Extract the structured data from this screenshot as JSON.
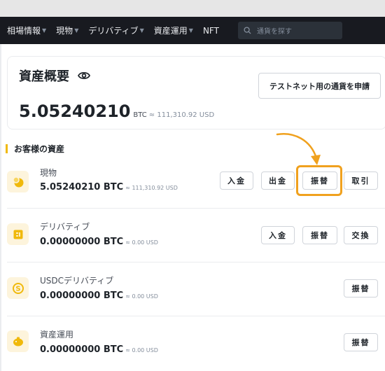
{
  "nav": {
    "items": [
      {
        "label": "相場情報",
        "caret": true
      },
      {
        "label": "現物",
        "caret": true
      },
      {
        "label": "デリバティブ",
        "caret": true
      },
      {
        "label": "資産運用",
        "caret": true
      },
      {
        "label": "NFT",
        "caret": false
      }
    ],
    "search_placeholder": "通貨を探す"
  },
  "summary": {
    "title": "資産概要",
    "balance": "5.05240210",
    "unit": "BTC",
    "fiat": "≈ 111,310.92 USD",
    "testnet_button": "テストネット用の通貨を申請"
  },
  "section": {
    "title": "お客様の資産"
  },
  "assets": [
    {
      "name": "現物",
      "balance": "5.05240210 BTC",
      "fiat": "≈ 111,310.92 USD",
      "icon": "spot-icon",
      "actions": [
        "入金",
        "出金",
        "振替",
        "取引"
      ]
    },
    {
      "name": "デリバティブ",
      "balance": "0.00000000 BTC",
      "fiat": "≈ 0.00 USD",
      "icon": "derivatives-icon",
      "actions": [
        "入金",
        "振替",
        "交換"
      ]
    },
    {
      "name": "USDCデリバティブ",
      "balance": "0.00000000 BTC",
      "fiat": "≈ 0.00 USD",
      "icon": "usdc-icon",
      "actions": [
        "振替"
      ]
    },
    {
      "name": "資産運用",
      "balance": "0.00000000 BTC",
      "fiat": "≈ 0.00 USD",
      "icon": "earn-icon",
      "actions": [
        "振替"
      ]
    }
  ],
  "colors": {
    "accent": "#f0b90b",
    "highlight": "#f0a11e",
    "nav_bg": "#181a20"
  }
}
